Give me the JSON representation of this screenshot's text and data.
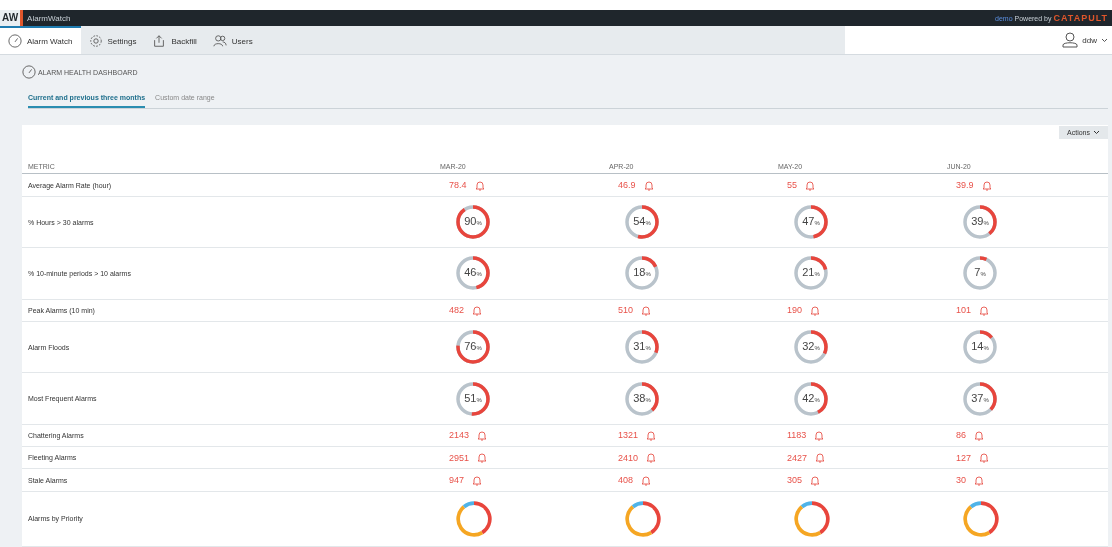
{
  "app_bar": {
    "logo": "AW",
    "title": "AlarmWatch",
    "env": "demo",
    "powered_by": "Powered by",
    "brand": "CATAPULT"
  },
  "nav": {
    "tabs": [
      {
        "label": "Alarm Watch",
        "selected": true
      },
      {
        "label": "Settings",
        "selected": false
      },
      {
        "label": "Backfill",
        "selected": false
      },
      {
        "label": "Users",
        "selected": false
      }
    ],
    "user": "ddw"
  },
  "page_title": "ALARM HEALTH DASHBOARD",
  "range_tabs": [
    {
      "label": "Current and previous three months",
      "selected": true
    },
    {
      "label": "Custom date range",
      "selected": false
    }
  ],
  "actions": "Actions",
  "table": {
    "columns": [
      "METRIC",
      "MAR-20",
      "APR-20",
      "MAY-20",
      "JUN-20"
    ],
    "rows": [
      {
        "metric": "Average Alarm Rate (hour)",
        "kind": "value",
        "cells": [
          {
            "value": "78.4"
          },
          {
            "value": "46.9"
          },
          {
            "value": "55"
          },
          {
            "value": "39.9"
          }
        ]
      },
      {
        "metric": "% Hours > 30 alarms",
        "kind": "percent",
        "cells": [
          {
            "value": "90",
            "unit": "%"
          },
          {
            "value": "54",
            "unit": "%"
          },
          {
            "value": "47",
            "unit": "%"
          },
          {
            "value": "39",
            "unit": "%"
          }
        ]
      },
      {
        "metric": "% 10-minute periods > 10 alarms",
        "kind": "percent",
        "cells": [
          {
            "value": "46",
            "unit": "%"
          },
          {
            "value": "18",
            "unit": "%"
          },
          {
            "value": "21",
            "unit": "%"
          },
          {
            "value": "7",
            "unit": "%"
          }
        ]
      },
      {
        "metric": "Peak Alarms (10 min)",
        "kind": "value",
        "cells": [
          {
            "value": "482"
          },
          {
            "value": "510"
          },
          {
            "value": "190"
          },
          {
            "value": "101"
          }
        ]
      },
      {
        "metric": "Alarm Floods",
        "kind": "percent",
        "cells": [
          {
            "value": "76",
            "unit": "%"
          },
          {
            "value": "31",
            "unit": "%"
          },
          {
            "value": "32",
            "unit": "%"
          },
          {
            "value": "14",
            "unit": "%"
          }
        ]
      },
      {
        "metric": "Most Frequent Alarms",
        "kind": "percent",
        "cells": [
          {
            "value": "51",
            "unit": "%"
          },
          {
            "value": "38",
            "unit": "%"
          },
          {
            "value": "42",
            "unit": "%"
          },
          {
            "value": "37",
            "unit": "%"
          }
        ]
      },
      {
        "metric": "Chattering Alarms",
        "kind": "value",
        "cells": [
          {
            "value": "2143"
          },
          {
            "value": "1321"
          },
          {
            "value": "1183"
          },
          {
            "value": "86"
          }
        ]
      },
      {
        "metric": "Fleeting Alarms",
        "kind": "value",
        "cells": [
          {
            "value": "2951"
          },
          {
            "value": "2410"
          },
          {
            "value": "2427"
          },
          {
            "value": "127"
          }
        ]
      },
      {
        "metric": "Stale Alarms",
        "kind": "value",
        "cells": [
          {
            "value": "947"
          },
          {
            "value": "408"
          },
          {
            "value": "305"
          },
          {
            "value": "30"
          }
        ]
      },
      {
        "metric": "Alarms by Priority",
        "kind": "priority",
        "cells": [
          {},
          {},
          {},
          {}
        ]
      }
    ]
  }
}
